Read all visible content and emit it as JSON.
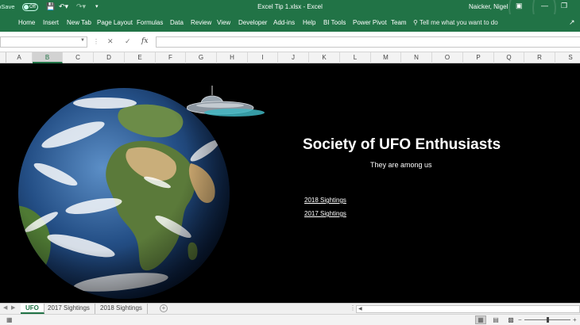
{
  "titlebar": {
    "autosave_label": "AutoSave",
    "autosave_state": "Off",
    "document_title": "Excel Tip 1.xlsx  -  Excel",
    "user_name": "Naicker, Nigel"
  },
  "ribbon": {
    "tabs": [
      "Home",
      "Insert",
      "New Tab",
      "Page Layout",
      "Formulas",
      "Data",
      "Review",
      "View",
      "Developer",
      "Add-ins",
      "Help",
      "BI Tools",
      "Power Pivot",
      "Team"
    ],
    "tell_me": "Tell me what you want to do"
  },
  "formula_bar": {
    "name_box": "",
    "formula": ""
  },
  "columns": [
    "A",
    "B",
    "C",
    "D",
    "E",
    "F",
    "G",
    "H",
    "I",
    "J",
    "K",
    "L",
    "M",
    "N",
    "O",
    "P",
    "Q",
    "R",
    "S"
  ],
  "selected_column": "B",
  "sheet_content": {
    "heading": "Society of UFO Enthusiasts",
    "subheading": "They are among us",
    "links": [
      "2018 Sightings",
      "2017 Sightings"
    ]
  },
  "sheet_tabs": [
    "UFO",
    "2017 Sightings",
    "2018 Sightings"
  ],
  "active_sheet": "UFO",
  "zoom_percent": 100,
  "colors": {
    "excel_green": "#217346",
    "sheet_background": "#000000",
    "text_white": "#ffffff"
  },
  "icons": {
    "save": "save-icon",
    "undo": "undo-icon",
    "redo": "redo-icon",
    "customize_qat": "customize-qat-icon",
    "ribbon_display": "ribbon-display-icon",
    "minimize": "minimize-icon",
    "restore": "restore-icon",
    "search": "lightbulb-search-icon",
    "share": "share-icon",
    "cancel": "cancel-icon",
    "enter": "enter-icon",
    "function": "insert-function-icon",
    "add_sheet": "add-sheet-icon",
    "zoom_out": "zoom-out-icon",
    "zoom_in": "zoom-in-icon"
  }
}
